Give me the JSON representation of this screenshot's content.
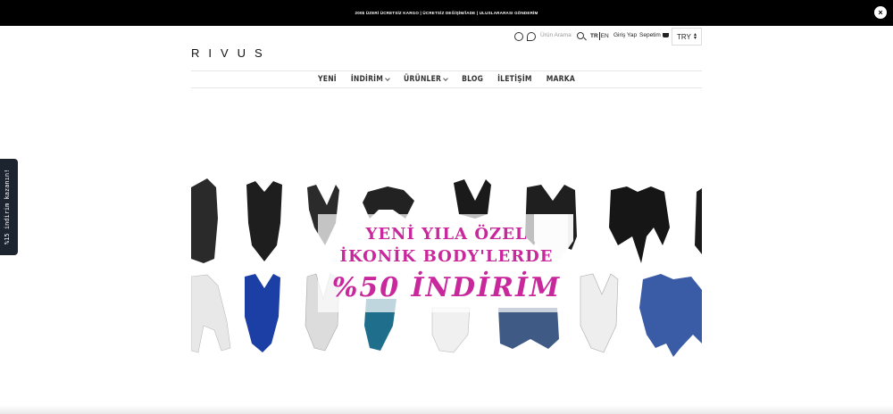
{
  "topbar": {
    "announcement": "200$ ÜZERİ ÜCRETSİZ KARGO   |   ÜCRETSİZ DEĞİŞİM/İADE   |   ULUSLARARASI GÖNDERİM",
    "close_label": "×"
  },
  "header": {
    "logo": "RIVUS",
    "search_placeholder": "Ürün Arama",
    "lang_tr": "TR",
    "lang_en": "EN",
    "login_label": "Giriş Yap",
    "cart_label": "Sepetim",
    "currency": "TRY"
  },
  "nav": {
    "items": [
      {
        "label": "YENİ",
        "dropdown": false
      },
      {
        "label": "İNDİRİM",
        "dropdown": true
      },
      {
        "label": "ÜRÜNLER",
        "dropdown": true
      },
      {
        "label": "BLOG",
        "dropdown": false
      },
      {
        "label": "İLETİŞİM",
        "dropdown": false
      },
      {
        "label": "MARKA",
        "dropdown": false
      }
    ]
  },
  "banner": {
    "line1": "YENİ YILA ÖZEL",
    "line2": "İKONİK BODY'LERDE",
    "line3": "%50 İNDİRİM",
    "accent_color": "#c8289c"
  },
  "side_tab": {
    "label": "%15 indirim kazanın!"
  }
}
